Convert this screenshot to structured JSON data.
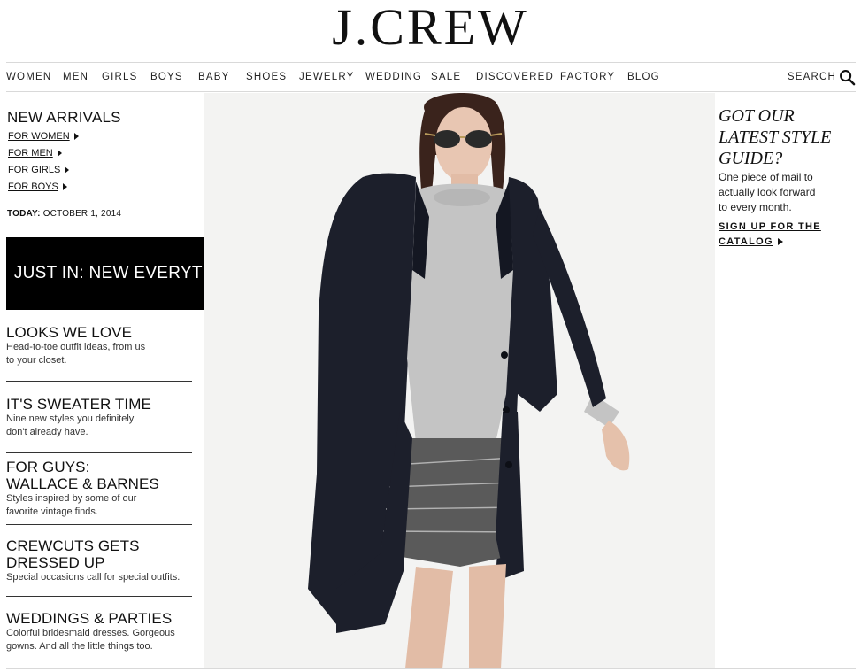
{
  "brand": {
    "logo_text": "J.CREW"
  },
  "nav": {
    "items": [
      "WOMEN",
      "MEN",
      "GIRLS",
      "BOYS",
      "BABY",
      "SHOES",
      "JEWELRY",
      "WEDDING",
      "SALE",
      "DISCOVERED",
      "FACTORY",
      "BLOG"
    ],
    "search_label": "SEARCH",
    "search_icon": "magnifier-icon"
  },
  "left": {
    "new_arrivals": {
      "title": "NEW ARRIVALS",
      "links": [
        "FOR WOMEN",
        "FOR MEN",
        "FOR GIRLS",
        "FOR BOYS"
      ]
    },
    "today": {
      "label": "TODAY:",
      "date": "OCTOBER 1, 2014"
    },
    "promo": "JUST IN: NEW EVERYTHING!",
    "features": [
      {
        "title": "LOOKS WE LOVE",
        "desc": "Head-to-toe outfit ideas, from us\nto your closet."
      },
      {
        "title": "IT'S SWEATER TIME",
        "desc": "Nine new styles you definitely\ndon't already have."
      },
      {
        "title": "FOR GUYS:\nWALLACE & BARNES",
        "desc": "Styles inspired by some of our\nfavorite vintage finds."
      },
      {
        "title": "CREWCUTS GETS\nDRESSED UP",
        "desc": "Special occasions call for special outfits."
      },
      {
        "title": "WEDDINGS & PARTIES",
        "desc": "Colorful bridesmaid dresses. Gorgeous\ngowns. And all the little things too."
      }
    ]
  },
  "right": {
    "guide_title": "GOT OUR\nLATEST STYLE\nGUIDE?",
    "guide_desc": "One piece of mail to\nactually look forward\nto every month.",
    "guide_cta": "SIGN UP FOR THE\nCATALOG"
  },
  "colors": {
    "text": "#111111",
    "promo_bg": "#000000",
    "rule": "#d9d9d9"
  }
}
